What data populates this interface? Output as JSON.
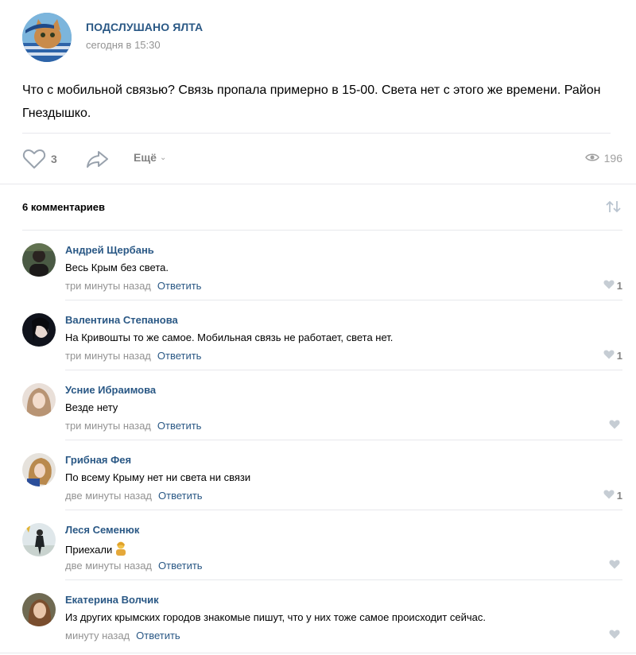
{
  "post": {
    "group_name": "ПОДСЛУШАНО ЯЛТА",
    "time": "сегодня в 15:30",
    "text": "Что с мобильной связью? Связь пропала примерно в 15-00. Света нет с этого же времени. Район Гнездышко.",
    "likes": "3",
    "more_label": "Ещё",
    "views": "196"
  },
  "comments_header": {
    "count_label": "6 комментариев"
  },
  "comments": [
    {
      "author": "Андрей Щербань",
      "text": "Весь Крым без света.",
      "time": "три минуты назад",
      "reply": "Ответить",
      "likes": "1",
      "avatar_color": "#3b4a3a"
    },
    {
      "author": "Валентина Степанова",
      "text": "На Кривошты то же самое. Мобильная связь не работает, света нет.",
      "time": "три минуты назад",
      "reply": "Ответить",
      "likes": "1",
      "avatar_color": "#1d2130"
    },
    {
      "author": "Усние Ибраимова",
      "text": "Везде нету",
      "time": "три минуты назад",
      "reply": "Ответить",
      "likes": "",
      "avatar_color": "#c9a98b"
    },
    {
      "author": "Грибная Фея",
      "text": "По всему Крыму нет ни света ни связи",
      "time": "две минуты назад",
      "reply": "Ответить",
      "likes": "1",
      "avatar_color": "#b58a52"
    },
    {
      "author": "Леся Семенюк",
      "text": "Приехали",
      "time": "две минуты назад",
      "reply": "Ответить",
      "likes": "",
      "avatar_color": "#b7c8cf"
    },
    {
      "author": "Екатерина Волчик",
      "text": "Из других крымских городов знакомые пишут, что у них тоже самое происходит сейчас.",
      "time": "минуту назад",
      "reply": "Ответить",
      "likes": "",
      "avatar_color": "#8e6f56"
    }
  ],
  "colors": {
    "link": "#2a5885",
    "muted": "#939393",
    "divider": "#e7e8ec"
  },
  "icons": {
    "like": "heart-icon",
    "share": "share-arrow-icon",
    "views": "eye-icon",
    "sort": "sort-arrows-icon",
    "emoji": "emoji-person-icon"
  }
}
